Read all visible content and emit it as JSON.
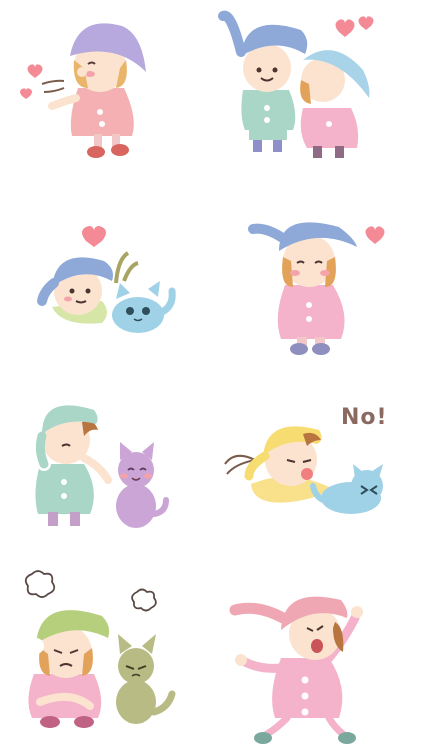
{
  "stickers": [
    {
      "name": "blowing-kiss"
    },
    {
      "name": "cheek-kiss"
    },
    {
      "name": "boy-with-cat-love"
    },
    {
      "name": "shy-girl-love"
    },
    {
      "name": "boy-petting-cat"
    },
    {
      "name": "boy-cat-refusing",
      "caption": "No!"
    },
    {
      "name": "angry-girl-with-cat"
    },
    {
      "name": "shouting-girl"
    }
  ],
  "palette": {
    "skin": "#fbe3cf",
    "hair": "#e2a25a",
    "lavender_hat": "#b7a9de",
    "blue_hat": "#8ea8d8",
    "pink_hat": "#f0a7b4",
    "mint_hat": "#a9d6c6",
    "yellow_hat": "#f7dc72",
    "green_hat": "#b6cf7c",
    "heart": "#f38a96",
    "cat_blue": "#9fd2e6",
    "cat_purple": "#caa5d6",
    "cat_olive": "#b8bb84"
  }
}
